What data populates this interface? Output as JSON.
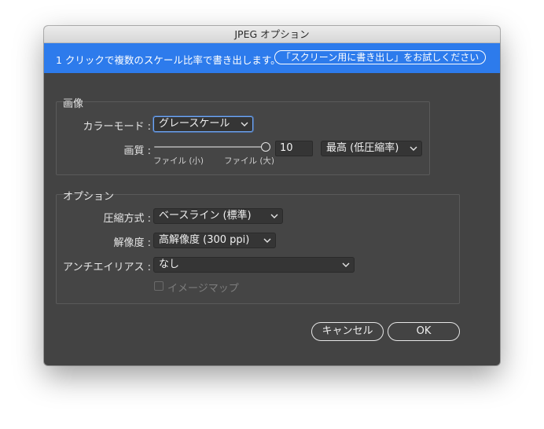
{
  "window": {
    "title": "JPEG オプション"
  },
  "banner": {
    "text": "1 クリックで複数のスケール比率で書き出します。",
    "button_label": "「スクリーン用に書き出し」をお試しください"
  },
  "image_group": {
    "title": "画像",
    "color_mode": {
      "label": "カラーモード :",
      "value": "グレースケール"
    },
    "quality": {
      "label": "画質 :",
      "min_label": "ファイル (小)",
      "max_label": "ファイル (大)",
      "value": "10",
      "slider_fraction": 1.0,
      "preset": "最高 (低圧縮率)"
    }
  },
  "options_group": {
    "title": "オプション",
    "compression": {
      "label": "圧縮方式 :",
      "value": "ベースライン (標準)"
    },
    "resolution": {
      "label": "解像度 :",
      "value": "高解像度 (300 ppi)"
    },
    "antialias": {
      "label": "アンチエイリアス :",
      "value": "なし"
    },
    "imagemap": {
      "label": "イメージマップ",
      "checked": false,
      "enabled": false
    }
  },
  "footer": {
    "cancel_label": "キャンセル",
    "ok_label": "OK"
  },
  "colors": {
    "dialog_bg": "#434343",
    "banner_blue": "#2d7bec",
    "focus_ring": "#6fa6f5"
  }
}
